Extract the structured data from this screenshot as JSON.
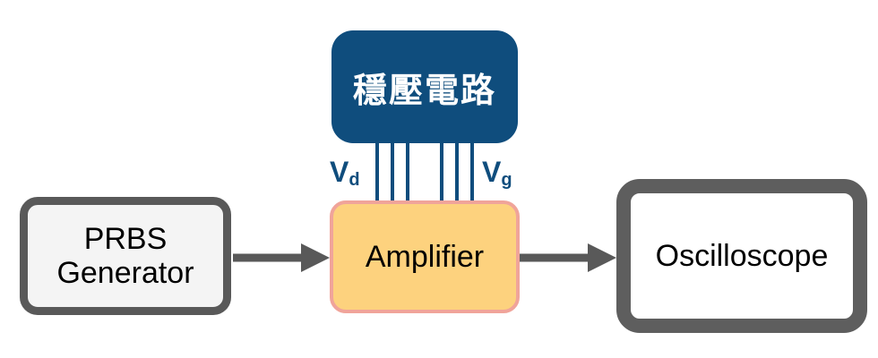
{
  "nodes": {
    "regulator": {
      "label": "穩壓電路",
      "color": "#0f4d7d"
    },
    "prbs": {
      "line1": "PRBS",
      "line2": "Generator",
      "fill": "#f4f4f4",
      "border": "#595959"
    },
    "amplifier": {
      "label": "Amplifier",
      "fill": "#fdd27e",
      "border": "#f0a49a"
    },
    "oscilloscope": {
      "label": "Oscilloscope",
      "border": "#5e5e5e"
    }
  },
  "labels": {
    "vd": {
      "main": "V",
      "sub": "d"
    },
    "vg": {
      "main": "V",
      "sub": "g"
    }
  },
  "edges": [
    {
      "from": "prbs",
      "to": "amplifier"
    },
    {
      "from": "amplifier",
      "to": "oscilloscope"
    },
    {
      "from": "regulator",
      "to": "amplifier",
      "label": "vd",
      "lines": 3
    },
    {
      "from": "regulator",
      "to": "amplifier",
      "label": "vg",
      "lines": 3
    }
  ],
  "colors": {
    "arrow": "#595959",
    "bus": "#0f4d7d"
  }
}
